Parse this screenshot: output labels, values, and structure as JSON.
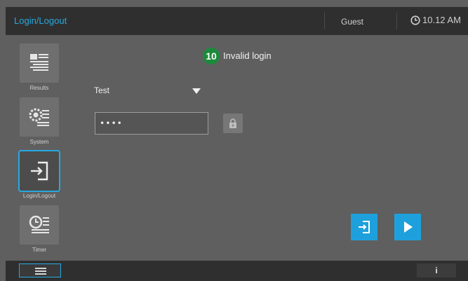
{
  "header": {
    "title": "Login/Logout",
    "user": "Guest",
    "time": "10.12 AM"
  },
  "sidebar": {
    "items": [
      {
        "label": "Results",
        "icon": "results-icon"
      },
      {
        "label": "System",
        "icon": "system-icon"
      },
      {
        "label": "Login/Logout",
        "icon": "login-icon",
        "active": true
      },
      {
        "label": "Timer",
        "icon": "timer-icon"
      }
    ]
  },
  "main": {
    "step_badge": "10",
    "message": "Invalid login",
    "user_select": {
      "value": "Test"
    },
    "password": {
      "value": "••••"
    }
  },
  "footer": {
    "info_label": "i"
  },
  "colors": {
    "accent": "#27a9e0",
    "badge": "#1b8a3a",
    "background": "#5f5f5f",
    "bar": "#2f2f2f"
  }
}
